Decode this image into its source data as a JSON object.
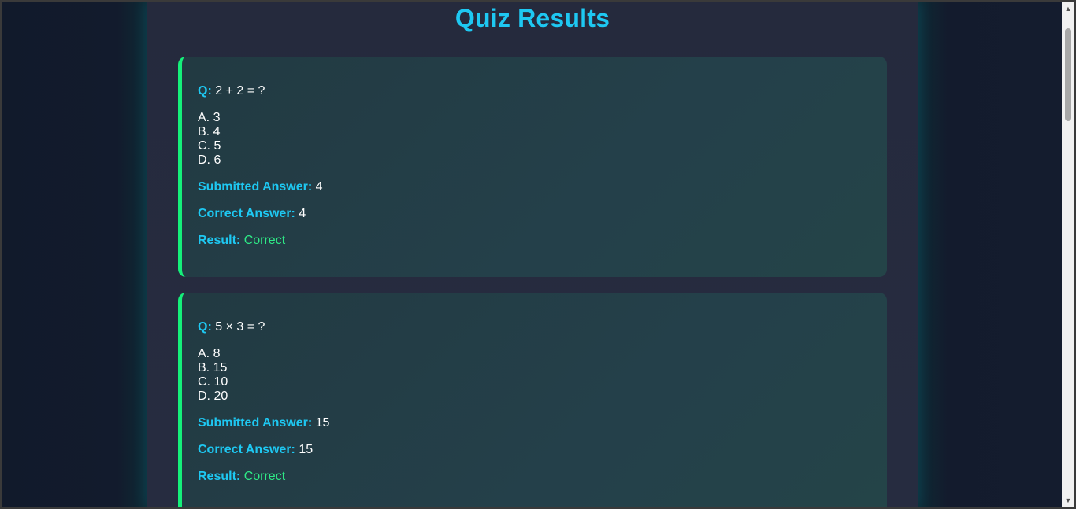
{
  "page": {
    "title": "Quiz Results"
  },
  "labels": {
    "question": "Q:",
    "submitted": "Submitted Answer:",
    "correct": "Correct Answer:",
    "result": "Result:"
  },
  "questions": [
    {
      "text": "2 + 2 = ?",
      "options": [
        "A. 3",
        "B. 4",
        "C. 5",
        "D. 6"
      ],
      "submitted": "4",
      "correct": "4",
      "result": "Correct"
    },
    {
      "text": "5 × 3 = ?",
      "options": [
        "A. 8",
        "B. 15",
        "C. 10",
        "D. 20"
      ],
      "submitted": "15",
      "correct": "15",
      "result": "Correct"
    }
  ],
  "colors": {
    "accent": "#1ec8f2",
    "correct_border": "#15f07a",
    "correct_text": "#2eea86"
  },
  "icons": {
    "scroll_up": "scroll-up-arrow-icon",
    "scroll_down": "scroll-down-arrow-icon"
  }
}
